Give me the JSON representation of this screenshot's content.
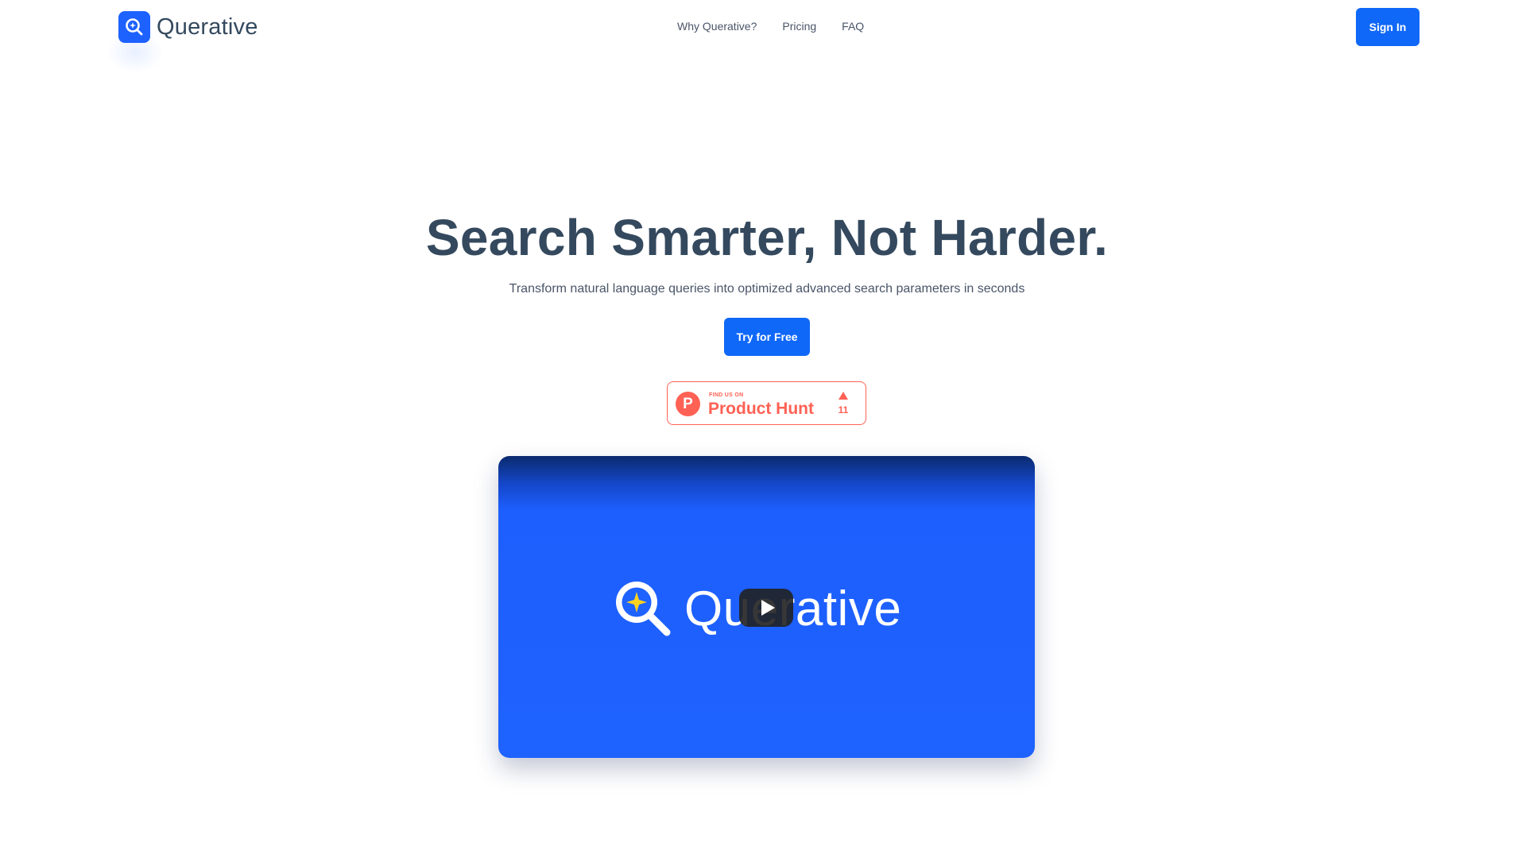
{
  "colors": {
    "brand_blue": "#1d62ff",
    "button_blue": "#1068f8",
    "heading": "#34495e",
    "product_hunt": "#ff6154"
  },
  "header": {
    "logo_text": "Querative",
    "logo_icon": "magnifier-sparkle-icon",
    "nav": [
      {
        "label": "Why Querative?"
      },
      {
        "label": "Pricing"
      },
      {
        "label": "FAQ"
      }
    ],
    "signin_label": "Sign In"
  },
  "hero": {
    "title": "Search Smarter, Not Harder.",
    "subtitle": "Transform natural language queries into optimized advanced search parameters in seconds",
    "cta_label": "Try for Free"
  },
  "product_hunt": {
    "eyebrow": "FIND US ON",
    "name": "Product Hunt",
    "logo_letter": "P",
    "upvotes": "11"
  },
  "video": {
    "brand_text": "Querative",
    "brand_icon": "magnifier-sparkle-icon",
    "play_icon": "play-icon"
  }
}
